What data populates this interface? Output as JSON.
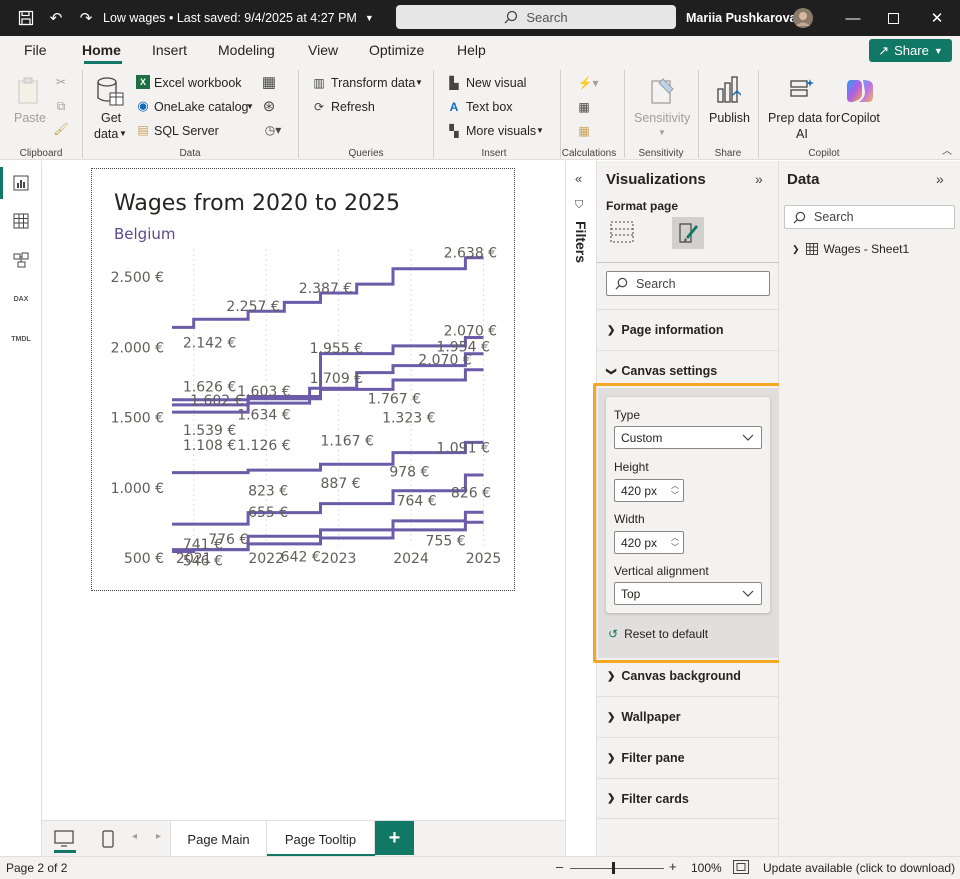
{
  "titlebar": {
    "title": "Low wages • Last saved: 9/4/2025 at 4:27 PM",
    "search_label": "Search",
    "user_name": "Mariia Pushkarova"
  },
  "menu": [
    "File",
    "Home",
    "Insert",
    "Modeling",
    "View",
    "Optimize",
    "Help"
  ],
  "share_label": "Share",
  "ribbon": {
    "paste": "Paste",
    "clipboard_group": "Clipboard",
    "get_data_line1": "Get",
    "get_data_line2": "data",
    "excel": "Excel workbook",
    "onelake": "OneLake catalog",
    "sql": "SQL Server",
    "data_group": "Data",
    "transform": "Transform data",
    "refresh": "Refresh",
    "queries_group": "Queries",
    "new_visual": "New visual",
    "text_box": "Text box",
    "more_visuals": "More visuals",
    "insert_group": "Insert",
    "calculations_group": "Calculations",
    "sensitivity": "Sensitivity",
    "sensitivity_group": "Sensitivity",
    "publish": "Publish",
    "share_group": "Share",
    "prep_line1": "Prep data for",
    "prep_line2": "AI",
    "copilot": "Copilot",
    "copilot_group": "Copilot"
  },
  "chart_data": {
    "type": "line",
    "title": "Wages from 2020 to 2025",
    "subtitle": "Belgium",
    "x_ticks": [
      "2021",
      "2022",
      "2023",
      "2024",
      "2025"
    ],
    "y_ticks": [
      "500 €",
      "1.000 €",
      "1.500 €",
      "2.000 €",
      "2.500 €"
    ],
    "ylim": [
      450,
      2700
    ],
    "xlim": [
      2020.7,
      2025.2
    ],
    "series": [
      {
        "color": "#6b5ba8",
        "points": [
          [
            2020.7,
            2142
          ],
          [
            2021,
            2142
          ],
          [
            2021,
            2200
          ],
          [
            2021.75,
            2200
          ],
          [
            2021.75,
            2257
          ],
          [
            2022.25,
            2257
          ],
          [
            2022.25,
            2320
          ],
          [
            2022.75,
            2320
          ],
          [
            2022.75,
            2387
          ],
          [
            2023.25,
            2387
          ],
          [
            2023.25,
            2450
          ],
          [
            2023.75,
            2450
          ],
          [
            2023.75,
            2560
          ],
          [
            2024.75,
            2560
          ],
          [
            2024.75,
            2638
          ],
          [
            2025,
            2638
          ]
        ]
      },
      {
        "color": "#6b5ba8",
        "points": [
          [
            2020.7,
            1626
          ],
          [
            2021.75,
            1626
          ],
          [
            2021.75,
            1650
          ],
          [
            2022.75,
            1650
          ],
          [
            2022.75,
            1955
          ],
          [
            2023.75,
            1955
          ],
          [
            2023.75,
            2010
          ],
          [
            2024.75,
            2010
          ],
          [
            2024.75,
            2070
          ],
          [
            2025,
            2070
          ]
        ]
      },
      {
        "color": "#6b5ba8",
        "points": [
          [
            2020.7,
            1590
          ],
          [
            2021.75,
            1590
          ],
          [
            2021.75,
            1603
          ],
          [
            2022.6,
            1603
          ],
          [
            2022.6,
            1709
          ],
          [
            2023.25,
            1709
          ],
          [
            2023.25,
            1820
          ],
          [
            2023.75,
            1820
          ],
          [
            2023.75,
            1870
          ],
          [
            2024.75,
            1870
          ],
          [
            2024.75,
            1954
          ],
          [
            2025,
            1954
          ]
        ]
      },
      {
        "color": "#6b5ba8",
        "points": [
          [
            2020.7,
            1539
          ],
          [
            2021.75,
            1539
          ],
          [
            2021.75,
            1634
          ],
          [
            2022.75,
            1634
          ],
          [
            2022.75,
            1700
          ],
          [
            2023.75,
            1700
          ],
          [
            2023.75,
            1767
          ],
          [
            2024.75,
            1767
          ],
          [
            2024.75,
            1840
          ],
          [
            2025,
            1840
          ]
        ]
      },
      {
        "color": "#6b5ba8",
        "points": [
          [
            2020.7,
            1108
          ],
          [
            2021.75,
            1108
          ],
          [
            2021.75,
            1126
          ],
          [
            2022.75,
            1126
          ],
          [
            2022.75,
            1167
          ],
          [
            2023.75,
            1167
          ],
          [
            2023.75,
            1250
          ],
          [
            2024.75,
            1250
          ],
          [
            2024.75,
            1323
          ],
          [
            2025,
            1323
          ]
        ]
      },
      {
        "color": "#6b5ba8",
        "points": [
          [
            2020.7,
            741
          ],
          [
            2021.75,
            741
          ],
          [
            2021.75,
            823
          ],
          [
            2022.75,
            823
          ],
          [
            2022.75,
            887
          ],
          [
            2023.75,
            887
          ],
          [
            2023.75,
            978
          ],
          [
            2024.75,
            978
          ],
          [
            2024.75,
            1091
          ],
          [
            2025,
            1091
          ]
        ]
      },
      {
        "color": "#6b5ba8",
        "points": [
          [
            2020.7,
            546
          ],
          [
            2021,
            546
          ],
          [
            2021,
            560
          ],
          [
            2021.75,
            560
          ],
          [
            2021.75,
            655
          ],
          [
            2022.75,
            655
          ],
          [
            2022.75,
            700
          ],
          [
            2023.75,
            700
          ],
          [
            2023.75,
            764
          ],
          [
            2024.75,
            764
          ],
          [
            2024.75,
            826
          ],
          [
            2025,
            826
          ]
        ]
      },
      {
        "color": "#6b5ba8",
        "points": [
          [
            2020.7,
            560
          ],
          [
            2021.75,
            560
          ],
          [
            2021.75,
            600
          ],
          [
            2022.75,
            600
          ],
          [
            2022.75,
            642
          ],
          [
            2023.75,
            642
          ],
          [
            2023.75,
            700
          ],
          [
            2024.75,
            700
          ],
          [
            2024.75,
            755
          ],
          [
            2025,
            755
          ]
        ]
      }
    ],
    "data_labels": [
      {
        "text": "2.638 €",
        "x": 2024.45,
        "y": 2638
      },
      {
        "text": "2.387 €",
        "x": 2022.45,
        "y": 2387
      },
      {
        "text": "2.257 €",
        "x": 2021.45,
        "y": 2257
      },
      {
        "text": "2.142 €",
        "x": 2020.85,
        "y": 2000
      },
      {
        "text": "2.070 €",
        "x": 2024.45,
        "y": 2085
      },
      {
        "text": "1.955 €",
        "x": 2022.6,
        "y": 1960
      },
      {
        "text": "1.954 €",
        "x": 2024.35,
        "y": 1970
      },
      {
        "text": "2.070 €",
        "x": 2024.1,
        "y": 1876
      },
      {
        "text": "1.709 €",
        "x": 2022.6,
        "y": 1745
      },
      {
        "text": "1.626 €",
        "x": 2020.85,
        "y": 1685
      },
      {
        "text": "1.603 €",
        "x": 2021.6,
        "y": 1655
      },
      {
        "text": "1.767 €",
        "x": 2023.4,
        "y": 1600
      },
      {
        "text": "1.602 €",
        "x": 2020.95,
        "y": 1590
      },
      {
        "text": "1.634 €",
        "x": 2021.6,
        "y": 1485
      },
      {
        "text": "1.323 €",
        "x": 2023.6,
        "y": 1465
      },
      {
        "text": "1.539 €",
        "x": 2020.85,
        "y": 1375
      },
      {
        "text": "1.108 €",
        "x": 2020.85,
        "y": 1270
      },
      {
        "text": "1.126 €",
        "x": 2021.6,
        "y": 1270
      },
      {
        "text": "1.167 €",
        "x": 2022.75,
        "y": 1300
      },
      {
        "text": "1.091 €",
        "x": 2024.35,
        "y": 1250
      },
      {
        "text": "978 €",
        "x": 2023.7,
        "y": 1080
      },
      {
        "text": "887 €",
        "x": 2022.75,
        "y": 1000
      },
      {
        "text": "823 €",
        "x": 2021.75,
        "y": 945
      },
      {
        "text": "826 €",
        "x": 2024.55,
        "y": 930
      },
      {
        "text": "764 €",
        "x": 2023.8,
        "y": 872
      },
      {
        "text": "655 €",
        "x": 2021.75,
        "y": 790
      },
      {
        "text": "741 €",
        "x": 2020.85,
        "y": 565
      },
      {
        "text": "776 €",
        "x": 2021.2,
        "y": 600
      },
      {
        "text": "546 €",
        "x": 2020.85,
        "y": 445
      },
      {
        "text": "642 €",
        "x": 2022.2,
        "y": 475
      },
      {
        "text": "755 €",
        "x": 2024.2,
        "y": 590
      }
    ]
  },
  "viz": {
    "title": "Visualizations",
    "format_page": "Format page",
    "search_placeholder": "Search",
    "page_information": "Page information",
    "canvas_settings": "Canvas settings",
    "type_label": "Type",
    "type_value": "Custom",
    "height_label": "Height",
    "height_value": "420 px",
    "width_label": "Width",
    "width_value": "420 px",
    "valign_label": "Vertical alignment",
    "valign_value": "Top",
    "reset": "Reset to default",
    "canvas_background": "Canvas background",
    "wallpaper": "Wallpaper",
    "filter_pane": "Filter pane",
    "filter_cards": "Filter cards",
    "highlight_color": "#f5a623"
  },
  "filters_label": "Filters",
  "data_pane": {
    "title": "Data",
    "search_placeholder": "Search",
    "table": "Wages - Sheet1"
  },
  "pages": {
    "tab1": "Page Main",
    "tab2": "Page Tooltip"
  },
  "status": {
    "page": "Page 2 of 2",
    "zoom": "100%",
    "update": "Update available (click to download)"
  }
}
